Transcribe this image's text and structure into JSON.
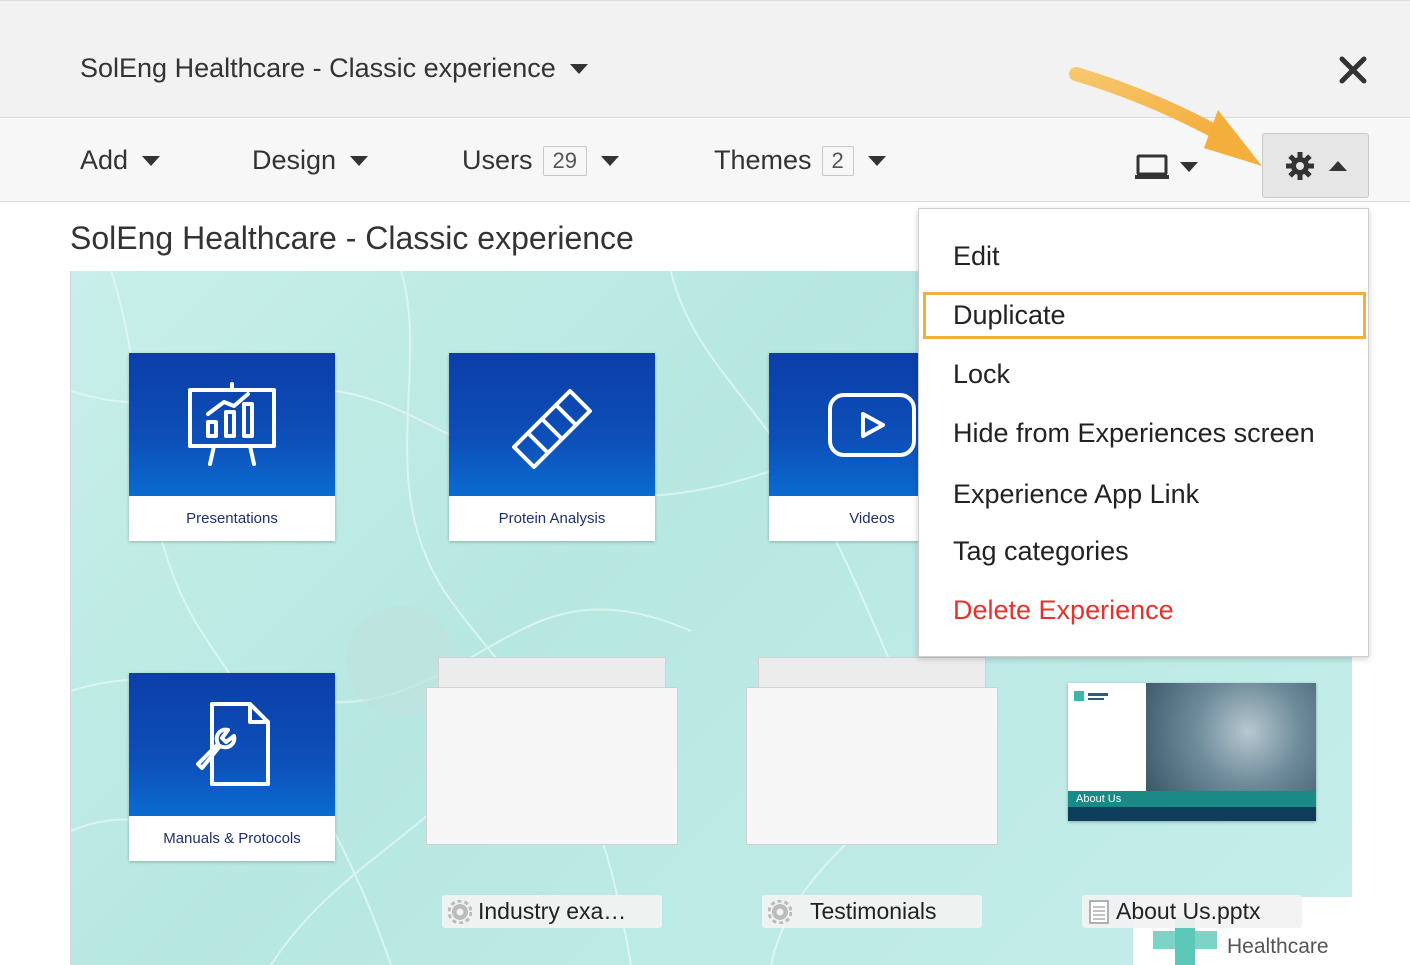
{
  "header": {
    "experience_title": "SolEng Healthcare - Classic experience"
  },
  "toolbar": {
    "add_label": "Add",
    "design_label": "Design",
    "users_label": "Users",
    "users_count": "29",
    "themes_label": "Themes",
    "themes_count": "2"
  },
  "page": {
    "title": "SolEng Healthcare - Classic experience"
  },
  "tiles": [
    {
      "label": "Presentations",
      "icon": "presentation-chart-icon"
    },
    {
      "label": "Protein Analysis",
      "icon": "dna-icon"
    },
    {
      "label": "Videos",
      "icon": "play-icon"
    },
    {
      "label": "Manuals & Protocols",
      "icon": "document-wrench-icon"
    }
  ],
  "items": [
    {
      "label": "Industry exa…",
      "icon": "gear-icon"
    },
    {
      "label": "Testimonials",
      "icon": "gear-icon"
    },
    {
      "label": "About Us.pptx",
      "icon": "file-icon"
    }
  ],
  "ppt_thumb": {
    "bar_text": "About Us"
  },
  "brand": {
    "text": "Healthcare"
  },
  "menu": {
    "items": [
      "Edit",
      "Duplicate",
      "Lock",
      "Hide from Experiences screen",
      "Experience App Link",
      "Tag categories"
    ],
    "danger_item": "Delete Experience"
  },
  "colors": {
    "accent_highlight": "#f4ae3c",
    "danger": "#e5322b",
    "tile_blue": "#0d4fb8",
    "canvas_bg": "#c3ece7"
  }
}
